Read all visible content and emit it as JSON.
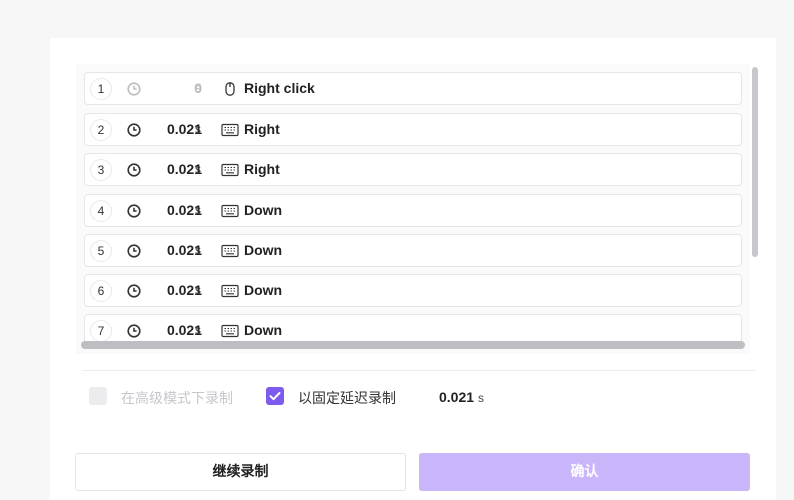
{
  "macro_list": {
    "rows": [
      {
        "index": "1",
        "delay": "0",
        "unit": "s",
        "action_icon": "mouse-icon",
        "label": "Right click"
      },
      {
        "index": "2",
        "delay": "0.021",
        "unit": "s",
        "action_icon": "keyboard-icon",
        "label": "Right"
      },
      {
        "index": "3",
        "delay": "0.021",
        "unit": "s",
        "action_icon": "keyboard-icon",
        "label": "Right"
      },
      {
        "index": "4",
        "delay": "0.021",
        "unit": "s",
        "action_icon": "keyboard-icon",
        "label": "Down"
      },
      {
        "index": "5",
        "delay": "0.021",
        "unit": "s",
        "action_icon": "keyboard-icon",
        "label": "Down"
      },
      {
        "index": "6",
        "delay": "0.021",
        "unit": "s",
        "action_icon": "keyboard-icon",
        "label": "Down"
      },
      {
        "index": "7",
        "delay": "0.021",
        "unit": "s",
        "action_icon": "keyboard-icon",
        "label": "Down"
      }
    ]
  },
  "options": {
    "advanced_mode": {
      "label": "在高级模式下录制",
      "checked": false,
      "disabled": true
    },
    "fixed_delay": {
      "label": "以固定延迟录制",
      "checked": true,
      "value": "0.021",
      "unit": "s"
    }
  },
  "buttons": {
    "continue_label": "继续录制",
    "confirm_label": "确认"
  },
  "colors": {
    "accent": "#7e5bef",
    "confirm_button": "#c8b5fa"
  }
}
